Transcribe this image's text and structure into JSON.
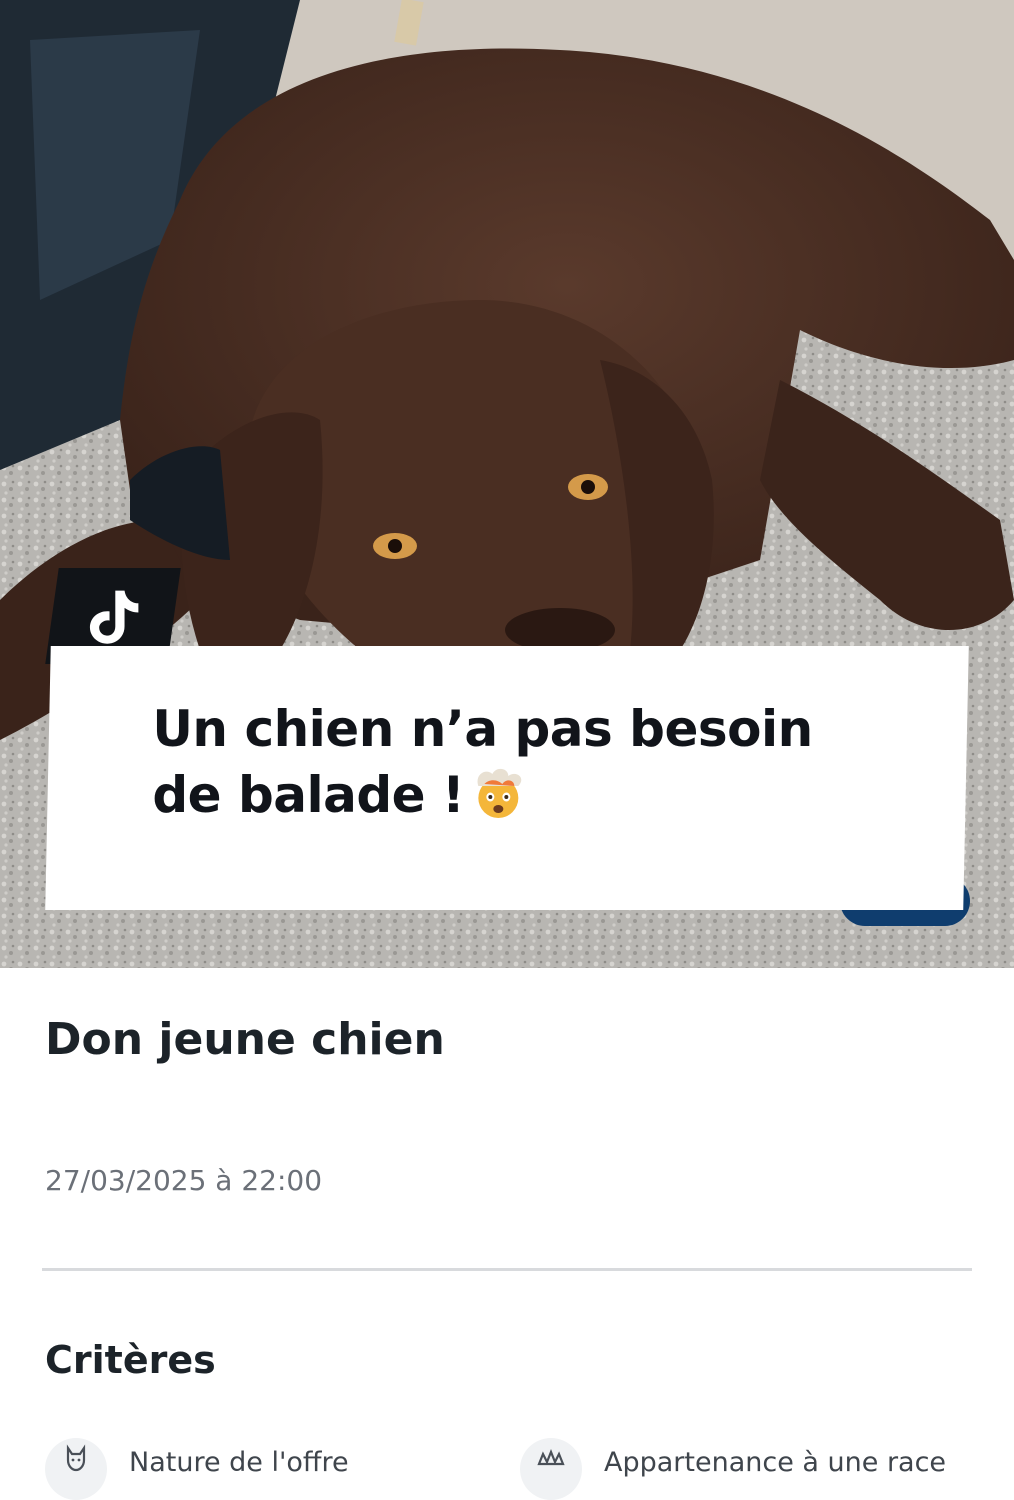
{
  "caption": {
    "line1": "Un chien n’a pas besoin",
    "line2": "de balade !"
  },
  "listing": {
    "title": "Don jeune chien",
    "date": "27/03/2025 à 22:00"
  },
  "criteria": {
    "section_title": "Critères",
    "items": [
      {
        "label": "Nature de l'offre",
        "icon": "cat-icon"
      },
      {
        "label": "Appartenance à une race",
        "icon": "pedigree-icon"
      }
    ]
  },
  "colors": {
    "accent": "#0f3d6e",
    "text": "#1c2329",
    "muted": "#6b7078"
  }
}
